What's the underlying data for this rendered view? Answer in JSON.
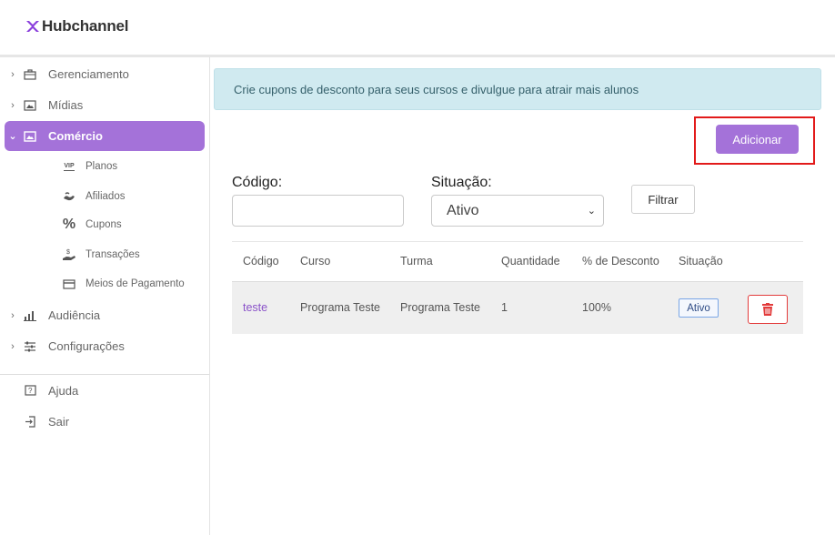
{
  "app": {
    "logo_text": "Hubchannel"
  },
  "sidebar": {
    "items": [
      {
        "label": "Gerenciamento",
        "icon": "briefcase-icon"
      },
      {
        "label": "Mídias",
        "icon": "image-folder-icon"
      },
      {
        "label": "Comércio",
        "icon": "image-icon",
        "active": true
      },
      {
        "label": "Audiência",
        "icon": "bar-chart-icon"
      },
      {
        "label": "Configurações",
        "icon": "sliders-icon"
      }
    ],
    "sub_items": [
      {
        "label": "Planos",
        "icon": "vip-icon"
      },
      {
        "label": "Afiliados",
        "icon": "handshake-icon"
      },
      {
        "label": "Cupons",
        "icon": "percent-icon"
      },
      {
        "label": "Transações",
        "icon": "money-hand-icon"
      },
      {
        "label": "Meios de Pagamento",
        "icon": "credit-card-icon"
      }
    ],
    "footer": [
      {
        "label": "Ajuda",
        "icon": "help-icon"
      },
      {
        "label": "Sair",
        "icon": "logout-icon"
      }
    ],
    "vip_text": "VIP",
    "percent_glyph": "%"
  },
  "main": {
    "banner": "Crie cupons de desconto para seus cursos e divulgue para atrair mais alunos",
    "add_button": "Adicionar",
    "filters": {
      "code_label": "Código:",
      "code_value": "",
      "status_label": "Situação:",
      "status_value": "Ativo",
      "filter_button": "Filtrar"
    },
    "table": {
      "headers": [
        "Código",
        "Curso",
        "Turma",
        "Quantidade",
        "% de Desconto",
        "Situação"
      ],
      "rows": [
        {
          "codigo": "teste",
          "curso": "Programa Teste",
          "turma": "Programa Teste",
          "quantidade": "1",
          "desconto": "100%",
          "situacao": "Ativo"
        }
      ]
    }
  },
  "colors": {
    "accent": "#a472d9",
    "banner_bg": "#d0eaf0",
    "danger": "#e23b3b",
    "highlight": "#e21a1a"
  }
}
